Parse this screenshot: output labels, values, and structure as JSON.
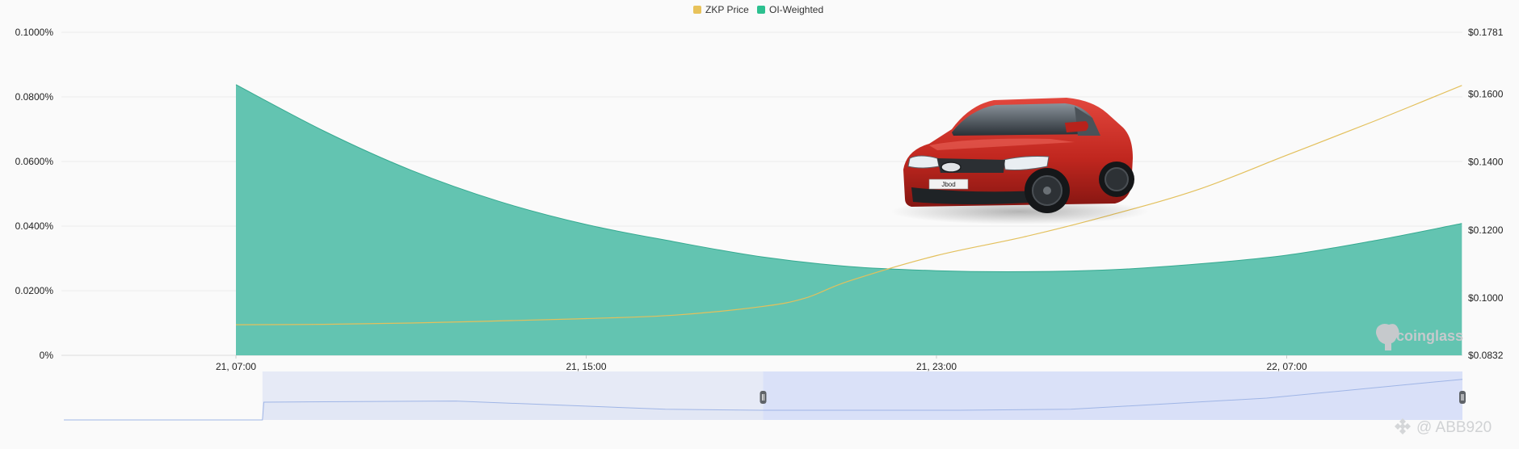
{
  "legend": [
    {
      "label": "ZKP Price",
      "color": "#e8c25a"
    },
    {
      "label": "OI-Weighted",
      "color": "#2cc08f"
    }
  ],
  "watermark": {
    "text": "coinglass",
    "icon": "coinglass-logo-icon"
  },
  "credit": {
    "text": "@ ABB920",
    "icon": "binance-logo-icon"
  },
  "photo": {
    "icon": "red-sedan-car-icon",
    "plate": "Jbod"
  },
  "colors": {
    "area_fill": "#63c4b1",
    "area_stroke": "#35a990",
    "price_line": "#e3c05c",
    "grid": "#ececec",
    "nav_bg": "#e6eaf6",
    "nav_selected": "#d6def8",
    "nav_line": "#9fb5e6"
  },
  "chart_data": {
    "type": "area",
    "x_ticks": [
      "21, 07:00",
      "21, 15:00",
      "21, 23:00",
      "22, 07:00"
    ],
    "y_left_ticks": [
      "0%",
      "0.0200%",
      "0.0400%",
      "0.0600%",
      "0.0800%",
      "0.1000%"
    ],
    "y_left_range": [
      0,
      0.1
    ],
    "y_right_ticks": [
      "$0.0832",
      "$0.1000",
      "$0.1200",
      "$0.1400",
      "$0.1600",
      "$0.1781"
    ],
    "y_right_range": [
      0.0832,
      0.1781
    ],
    "series": [
      {
        "name": "OI-Weighted",
        "type": "area",
        "axis": "left",
        "points": [
          {
            "hour": 0,
            "value": 0.0838
          },
          {
            "hour": 2,
            "value": 0.0695
          },
          {
            "hour": 4,
            "value": 0.0573
          },
          {
            "hour": 6,
            "value": 0.0477
          },
          {
            "hour": 8,
            "value": 0.0405
          },
          {
            "hour": 10,
            "value": 0.0352
          },
          {
            "hour": 12,
            "value": 0.0305
          },
          {
            "hour": 14,
            "value": 0.0275
          },
          {
            "hour": 16,
            "value": 0.0262
          },
          {
            "hour": 18,
            "value": 0.0259
          },
          {
            "hour": 20,
            "value": 0.0265
          },
          {
            "hour": 22,
            "value": 0.0283
          },
          {
            "hour": 24,
            "value": 0.031
          },
          {
            "hour": 26,
            "value": 0.0355
          },
          {
            "hour": 28,
            "value": 0.0408
          }
        ]
      },
      {
        "name": "ZKP Price",
        "type": "line",
        "axis": "right",
        "points": [
          {
            "hour": 0,
            "value": 0.0922
          },
          {
            "hour": 2,
            "value": 0.0923
          },
          {
            "hour": 4,
            "value": 0.0927
          },
          {
            "hour": 6,
            "value": 0.0933
          },
          {
            "hour": 8,
            "value": 0.094
          },
          {
            "hour": 10,
            "value": 0.095
          },
          {
            "hour": 12,
            "value": 0.0975
          },
          {
            "hour": 13,
            "value": 0.1
          },
          {
            "hour": 14,
            "value": 0.105
          },
          {
            "hour": 16,
            "value": 0.1125
          },
          {
            "hour": 18,
            "value": 0.118
          },
          {
            "hour": 20,
            "value": 0.1245
          },
          {
            "hour": 22,
            "value": 0.132
          },
          {
            "hour": 24,
            "value": 0.142
          },
          {
            "hour": 26,
            "value": 0.152
          },
          {
            "hour": 28,
            "value": 0.1625
          }
        ]
      }
    ],
    "navigator": {
      "range_start_fraction": 0.5,
      "range_end_fraction": 1.0,
      "points": [
        {
          "t": 0.0,
          "v": 0.0
        },
        {
          "t": 0.142,
          "v": 0.0
        },
        {
          "t": 0.143,
          "v": 0.0366
        },
        {
          "t": 0.28,
          "v": 0.039
        },
        {
          "t": 0.43,
          "v": 0.022
        },
        {
          "t": 0.5,
          "v": 0.02
        },
        {
          "t": 0.64,
          "v": 0.02
        },
        {
          "t": 0.72,
          "v": 0.022
        },
        {
          "t": 0.86,
          "v": 0.045
        },
        {
          "t": 1.0,
          "v": 0.0838
        }
      ]
    }
  }
}
